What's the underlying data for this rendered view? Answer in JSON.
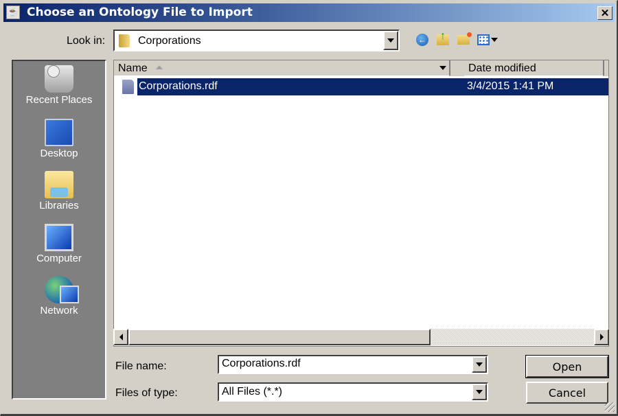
{
  "window": {
    "title": "Choose an Ontology File to Import",
    "app_icon": "java-icon",
    "close_label": "✕"
  },
  "lookin": {
    "label": "Look in:",
    "value": "Corporations",
    "icon": "folder-icon"
  },
  "toolbar": [
    {
      "name": "back-button",
      "icon": "back-arrow-icon"
    },
    {
      "name": "up-one-level-button",
      "icon": "folder-up-icon"
    },
    {
      "name": "create-new-folder-button",
      "icon": "new-folder-icon"
    },
    {
      "name": "view-menu-button",
      "icon": "view-menu-icon"
    }
  ],
  "places": [
    {
      "label": "Recent Places",
      "icon": "recent-places-icon"
    },
    {
      "label": "Desktop",
      "icon": "desktop-icon"
    },
    {
      "label": "Libraries",
      "icon": "libraries-icon"
    },
    {
      "label": "Computer",
      "icon": "computer-icon"
    },
    {
      "label": "Network",
      "icon": "network-icon"
    }
  ],
  "filelist": {
    "columns": [
      "Name",
      "Date modified"
    ],
    "sort": {
      "column": "Name",
      "direction": "ascending"
    },
    "rows": [
      {
        "name": "Corporations.rdf",
        "date": "3/4/2015 1:41 PM",
        "selected": true
      }
    ]
  },
  "form": {
    "filename_label": "File name:",
    "filename_value": "Corporations.rdf",
    "filetype_label": "Files of type:",
    "filetype_value": "All Files (*.*)"
  },
  "buttons": {
    "open": "Open",
    "cancel": "Cancel"
  },
  "colors": {
    "selection": "#0a246a",
    "title_start": "#0a246a",
    "title_end": "#a6caf0",
    "places_bg": "#808080",
    "face": "#d4d0c8"
  }
}
